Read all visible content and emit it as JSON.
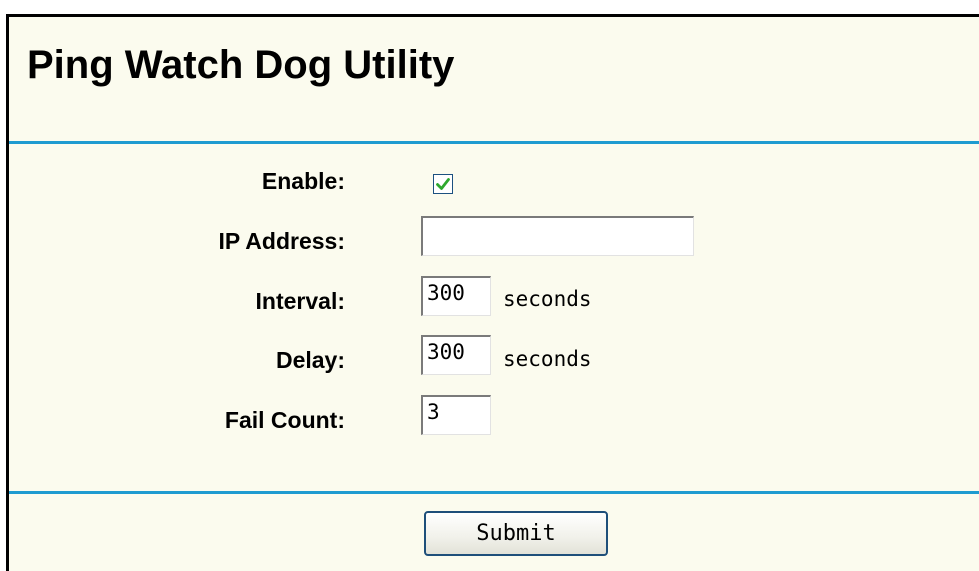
{
  "page": {
    "title": "Ping Watch Dog Utility"
  },
  "form": {
    "enable": {
      "label": "Enable:",
      "checked": true
    },
    "ip_address": {
      "label": "IP Address:",
      "value": ""
    },
    "interval": {
      "label": "Interval:",
      "value": "300",
      "unit": "seconds"
    },
    "delay": {
      "label": "Delay:",
      "value": "300",
      "unit": "seconds"
    },
    "fail_count": {
      "label": "Fail Count:",
      "value": "3"
    }
  },
  "actions": {
    "submit_label": "Submit"
  },
  "colors": {
    "background": "#fbfbee",
    "rule": "#1e9bd0",
    "checkmark": "#2ea82e"
  }
}
